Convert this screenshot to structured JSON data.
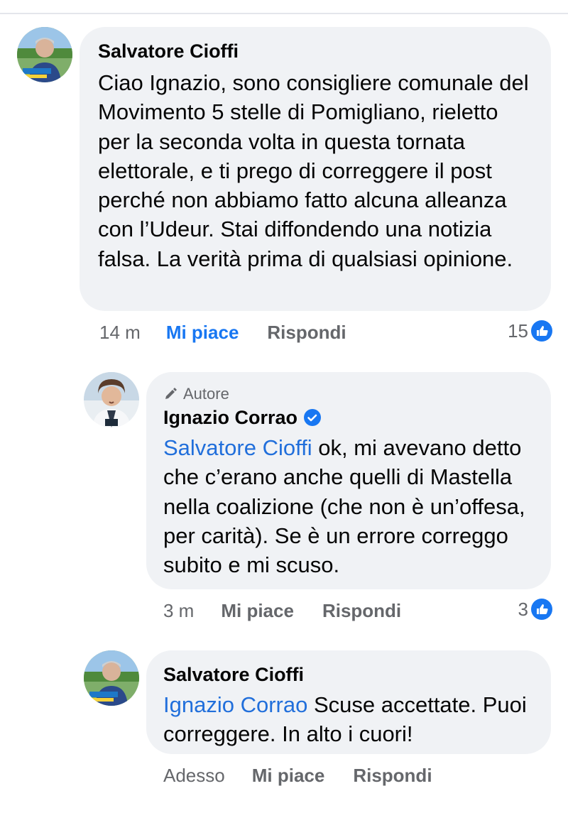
{
  "comments": [
    {
      "author": "Salvatore Cioffi",
      "badge": "",
      "mention": "",
      "text": "Ciao Ignazio, sono consigliere comunale del Movimento 5 stelle di Pomigliano, rieletto per la seconda volta in questa tornata elettorale, e ti prego di correggere il post perché non abbiamo fatto alcuna alleanza con l’Udeur. Stai diffondendo una notizia falsa. La verità prima di qualsiasi opinione.",
      "time": "14 m",
      "like_label": "Mi piace",
      "like_active": true,
      "reply_label": "Rispondi",
      "reaction_count": "15",
      "avatar_icon": "profile-photo"
    },
    {
      "author": "Ignazio Corrao",
      "badge": "Autore",
      "verified": true,
      "mention": "Salvatore Cioffi",
      "text": " ok, mi avevano detto che c’erano anche quelli di Mastella nella coalizione (che non è un’offesa, per carità). Se è un errore correggo subito e mi scuso.",
      "time": "3 m",
      "like_label": "Mi piace",
      "like_active": false,
      "reply_label": "Rispondi",
      "reaction_count": "3",
      "avatar_icon": "profile-photo"
    },
    {
      "author": "Salvatore Cioffi",
      "badge": "",
      "mention": "Ignazio Corrao",
      "text": " Scuse accettate. Puoi correggere. In alto i cuori!",
      "time": "Adesso",
      "like_label": "Mi piace",
      "like_active": false,
      "reply_label": "Rispondi",
      "reaction_count": "",
      "avatar_icon": "profile-photo"
    }
  ],
  "colors": {
    "bubble": "#f0f2f5",
    "mention": "#216fdb",
    "like_active": "#1877f2",
    "meta": "#65676b"
  }
}
